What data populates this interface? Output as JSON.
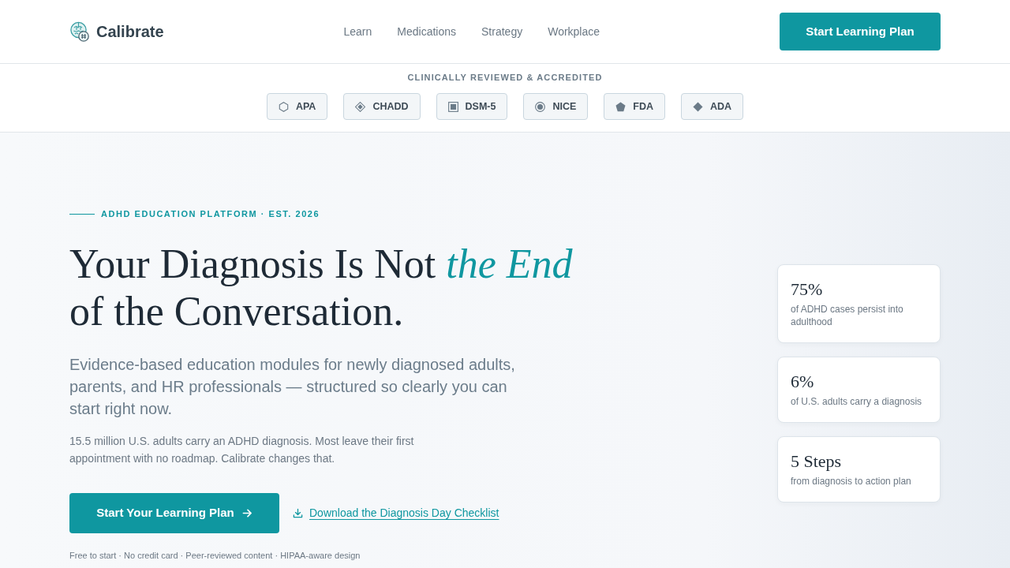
{
  "brand": {
    "name": "Calibrate"
  },
  "nav": {
    "links": [
      "Learn",
      "Medications",
      "Strategy",
      "Workplace"
    ],
    "cta": "Start Learning Plan"
  },
  "accreditation": {
    "label": "CLINICALLY REVIEWED & ACCREDITED",
    "badges": [
      {
        "label": "APA"
      },
      {
        "label": "CHADD"
      },
      {
        "label": "DSM-5"
      },
      {
        "label": "NICE"
      },
      {
        "label": "FDA"
      },
      {
        "label": "ADA"
      }
    ]
  },
  "hero": {
    "eyebrow": "ADHD EDUCATION PLATFORM · EST. 2026",
    "headline": "Your Diagnosis Is Not *the End* of the Conversation.",
    "lead": "Evidence-based education modules for newly diagnosed adults, parents, and HR professionals — structured so clearly you can start right now.",
    "body": "15.5 million U.S. adults carry an ADHD diagnosis. Most leave their first appointment with no roadmap. Calibrate changes that.",
    "primary_button": "Start Your Learning Plan",
    "download_link": "Download the Diagnosis Day Checklist",
    "note": "Free to start · No credit card · Peer-reviewed content · HIPAA-aware design"
  },
  "stats": [
    {
      "value": "75%",
      "label": "of ADHD cases persist into adulthood"
    },
    {
      "value": "6%",
      "label": "of U.S. adults carry a diagnosis"
    },
    {
      "value": "5 Steps",
      "label": "from diagnosis to action plan"
    }
  ]
}
